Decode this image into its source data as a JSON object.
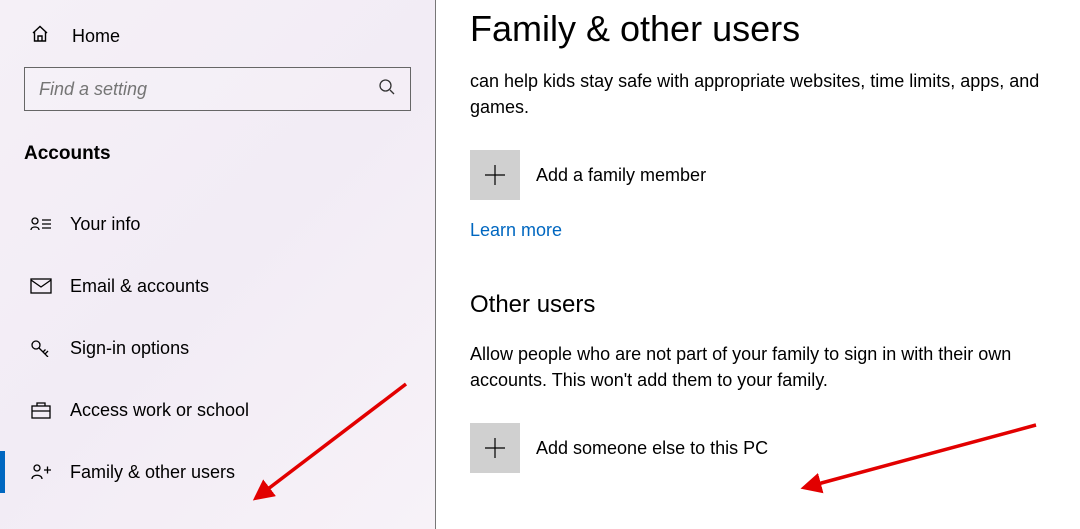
{
  "sidebar": {
    "home": "Home",
    "search_placeholder": "Find a setting",
    "section": "Accounts",
    "items": [
      {
        "label": "Your info"
      },
      {
        "label": "Email & accounts"
      },
      {
        "label": "Sign-in options"
      },
      {
        "label": "Access work or school"
      },
      {
        "label": "Family & other users"
      }
    ]
  },
  "main": {
    "title": "Family & other users",
    "family_desc": "can help kids stay safe with appropriate websites, time limits, apps, and games.",
    "add_family": "Add a family member",
    "learn_more": "Learn more",
    "other_title": "Other users",
    "other_desc": "Allow people who are not part of your family to sign in with their own accounts. This won't add them to your family.",
    "add_other": "Add someone else to this PC"
  }
}
